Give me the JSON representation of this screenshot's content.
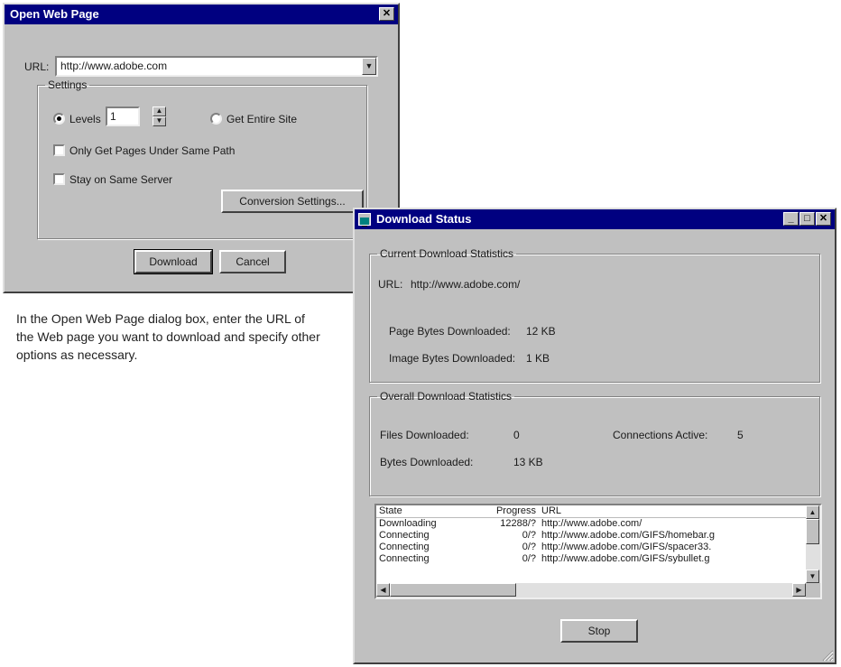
{
  "open_dialog": {
    "title": "Open Web Page",
    "url_label": "URL:",
    "url_value": "http://www.adobe.com",
    "settings_label": "Settings",
    "levels_label": "Levels",
    "levels_value": "1",
    "get_entire_site_label": "Get Entire Site",
    "only_same_path_label": "Only Get Pages Under Same Path",
    "stay_same_server_label": "Stay on Same Server",
    "conversion_settings_label": "Conversion Settings...",
    "download_label": "Download",
    "cancel_label": "Cancel"
  },
  "caption": "In the Open Web Page dialog box, enter the URL of the Web page you want to download and specify other options as necessary.",
  "status_window": {
    "title": "Download Status",
    "current_group_label": "Current Download Statistics",
    "url_label": "URL:",
    "url_value": "http://www.adobe.com/",
    "page_bytes_label": "Page Bytes Downloaded:",
    "page_bytes_value": "12 KB",
    "image_bytes_label": "Image Bytes Downloaded:",
    "image_bytes_value": "1 KB",
    "overall_group_label": "Overall Download Statistics",
    "files_label": "Files Downloaded:",
    "files_value": "0",
    "connections_label": "Connections Active:",
    "connections_value": "5",
    "bytes_label": "Bytes Downloaded:",
    "bytes_value": "13 KB",
    "table": {
      "headers": [
        "State",
        "Progress",
        "URL"
      ],
      "rows": [
        [
          "Downloading",
          "12288/?",
          "http://www.adobe.com/"
        ],
        [
          "Connecting",
          "0/?",
          "http://www.adobe.com/GIFS/homebar.g"
        ],
        [
          "Connecting",
          "0/?",
          "http://www.adobe.com/GIFS/spacer33."
        ],
        [
          "Connecting",
          "0/?",
          "http://www.adobe.com/GIFS/sybullet.g"
        ]
      ]
    },
    "stop_label": "Stop"
  },
  "colors": {
    "titlebar": "#000080",
    "window_face": "#c0c0c0"
  }
}
